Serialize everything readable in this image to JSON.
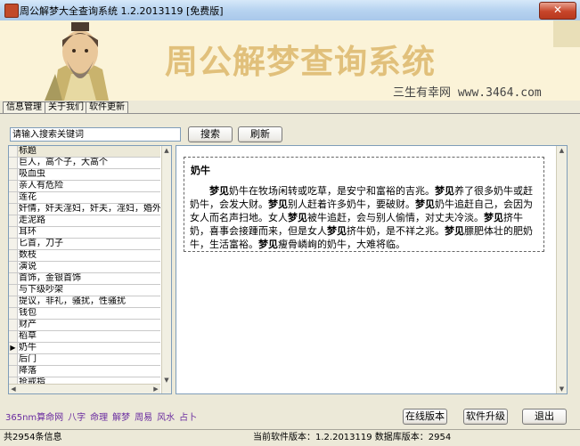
{
  "window": {
    "title": "周公解梦大全查询系统 1.2.2013119 [免费版]",
    "close_label": "✕"
  },
  "banner": {
    "title": "周公解梦查询系统",
    "subtitle": "三生有幸网 www.3464.com"
  },
  "tabs": [
    "信息管理",
    "关于我们",
    "软件更新"
  ],
  "search": {
    "value": "请输入搜索关键词",
    "search_label": "搜索",
    "refresh_label": "刷新"
  },
  "list": {
    "header": "标题",
    "selected_index": 16,
    "items": [
      "巨人，高个子，大高个",
      "吸血虫",
      "亲人有危险",
      "莲花",
      "奸情，奸夫淫妇，奸夫，淫妇，婚外情",
      "走泥路",
      "耳环",
      "匕首，刀子",
      "数枝",
      "演说",
      "首饰，金银首饰",
      "与下级吵架",
      "提议，非礼，骚扰，性骚扰",
      "钱包",
      "财产",
      "稻草",
      "奶牛",
      "后门",
      "降落",
      "抢戒指"
    ]
  },
  "content": {
    "heading": "奶牛",
    "paragraph_html": "<b>梦见</b>奶牛在牧场闲转或吃草，是安宁和富裕的吉兆。<b>梦见</b>养了很多奶牛或赶奶牛，会发大财。<b>梦见</b>别人赶着许多奶牛，要破财。<b>梦见</b>奶牛追赶自己，会因为女人而名声扫地。女人<b>梦见</b>被牛追赶，会与别人偷情，对丈夫冷淡。<b>梦见</b>挤牛奶，喜事会接踵而来，但是女人<b>梦见</b>挤牛奶，是不祥之兆。<b>梦见</b>膘肥体壮的肥奶牛，生活富裕。<b>梦见</b>瘦骨嶙峋的奶牛，大难将临。"
  },
  "footer": {
    "links": [
      "365nm算命网",
      "八字",
      "命理",
      "解梦",
      "周易",
      "风水",
      "占卜"
    ],
    "online_label": "在线版本",
    "upgrade_label": "软件升级",
    "exit_label": "退出"
  },
  "status": {
    "count": "共2954条信息",
    "version": "当前软件版本：1.2.2013119 数据库版本：2954"
  },
  "colors": {
    "banner_bg": "#fbf3d8",
    "banner_title": "#e1c07b",
    "link": "#6a2ca0",
    "close": "#c7452a"
  }
}
